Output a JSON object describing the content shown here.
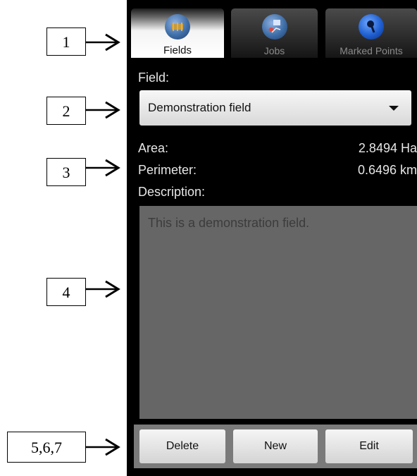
{
  "tabs": [
    {
      "label": "Fields",
      "icon": "field-globe-icon",
      "active": true
    },
    {
      "label": "Jobs",
      "icon": "jobs-globe-icon",
      "active": false
    },
    {
      "label": "Marked Points",
      "icon": "map-pin-icon",
      "active": false
    }
  ],
  "field": {
    "label": "Field:",
    "selected": "Demonstration field"
  },
  "stats": {
    "area_label": "Area:",
    "area_value": "2.8494 Ha",
    "perimeter_label": "Perimeter:",
    "perimeter_value": "0.6496 km"
  },
  "description": {
    "label": "Description:",
    "text": "This is a demonstration field."
  },
  "buttons": {
    "delete": "Delete",
    "new": "New",
    "edit": "Edit"
  },
  "callouts": [
    "1",
    "2",
    "3",
    "4",
    "5,6,7"
  ],
  "colors": {
    "screen_bg": "#000000",
    "text": "#e6e6e6",
    "description_bg": "#666666",
    "button_bar_bg": "#7a7a7a"
  }
}
